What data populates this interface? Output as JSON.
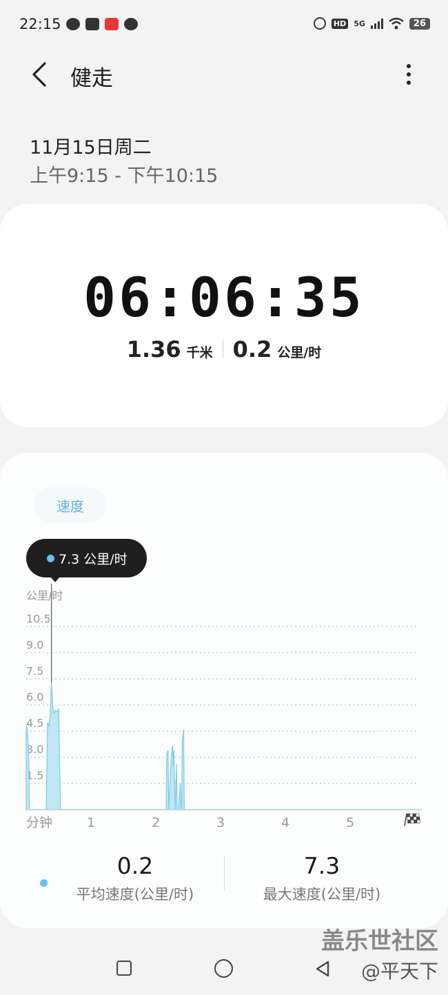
{
  "status_bar": {
    "time": "22:15",
    "network": "5G",
    "hd": "HD",
    "battery": "26"
  },
  "header": {
    "title": "健走"
  },
  "session": {
    "date": "11月15日周二",
    "time_range": "上午9:15 - 下午10:15"
  },
  "summary_card": {
    "duration": "06:06:35",
    "distance": "1.36",
    "distance_unit": "千米",
    "speed": "0.2",
    "speed_unit": "公里/时"
  },
  "speed_card": {
    "tab_label": "速度",
    "tooltip_value": "7.3 公里/时",
    "avg_value": "0.2",
    "avg_label": "平均速度(公里/时)",
    "max_value": "7.3",
    "max_label": "最大速度(公里/时)"
  },
  "chart_data": {
    "type": "area",
    "ylabel": "公里/时",
    "xlabel": "分钟",
    "y_ticks": [
      "1.5",
      "3.0",
      "4.5",
      "6.0",
      "7.5",
      "9.0",
      "10.5"
    ],
    "x_ticks": [
      "1",
      "2",
      "3",
      "4",
      "5"
    ],
    "ylim": [
      0,
      12
    ],
    "xlim": [
      0,
      6
    ],
    "grid": true,
    "color": "#bfe6f3",
    "line_color": "#7fcbe6",
    "series": [
      {
        "x": [
          0,
          0.01,
          0.02,
          0.04,
          0.05,
          0.06,
          0.31,
          0.33,
          0.35,
          0.37,
          0.39,
          0.41,
          0.43,
          0.45,
          0.48,
          0.5,
          0.53,
          0.54,
          1.0,
          2.16,
          2.17,
          2.19,
          2.2,
          2.24,
          2.26,
          2.27,
          2.28,
          2.3,
          2.32,
          2.33,
          2.35,
          2.38,
          2.39,
          2.4,
          2.41,
          2.43,
          2.44,
          2.46,
          2.47,
          6.0
        ],
        "y": [
          4.5,
          4.8,
          4.5,
          3.0,
          0,
          0,
          0,
          5.0,
          4.8,
          5.5,
          7.3,
          6.0,
          5.5,
          5.7,
          5.6,
          5.8,
          0,
          0,
          0,
          0,
          3.2,
          3.4,
          0,
          3.2,
          3.7,
          2.5,
          3.4,
          0,
          2.6,
          0,
          0,
          1.5,
          0,
          0,
          3.9,
          4.6,
          0,
          0,
          0,
          0
        ]
      }
    ],
    "highlight": {
      "x": 0.39,
      "y": 7.3
    }
  },
  "watermark": {
    "line1": "盖乐世社区",
    "line2": "@平天下"
  }
}
